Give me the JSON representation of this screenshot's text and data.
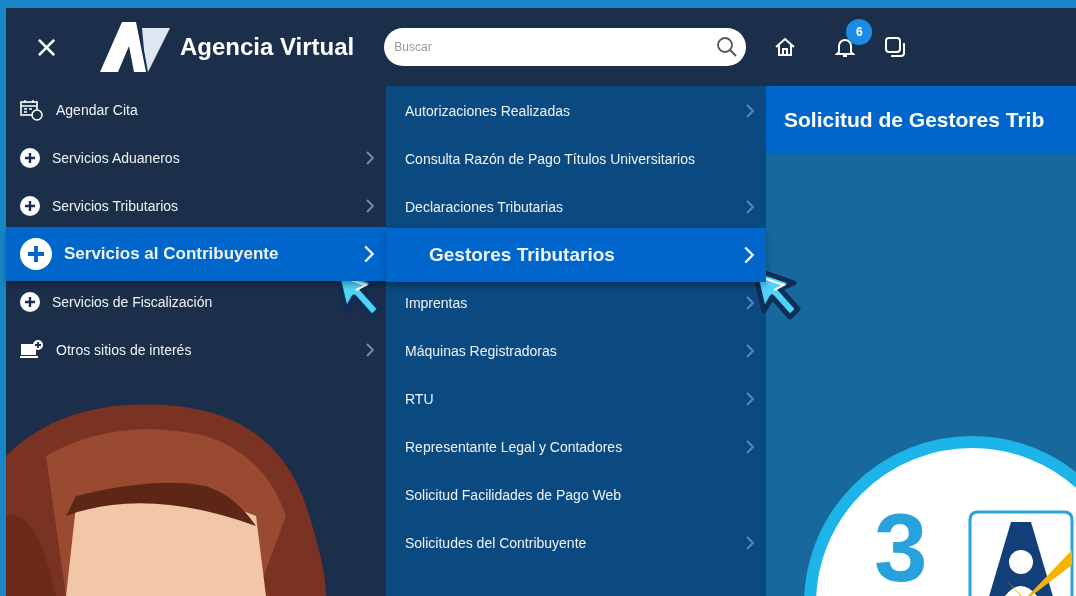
{
  "header": {
    "close": "×",
    "brand": "Agencia Virtual",
    "search": {
      "placeholder": "Buscar"
    },
    "notifications_count": "6"
  },
  "menu": [
    {
      "label": "Agendar Cita",
      "kind": "calendar",
      "has_submenu": false,
      "selected": false
    },
    {
      "label": "Servicios Aduaneros",
      "kind": "plus",
      "has_submenu": true,
      "selected": false
    },
    {
      "label": "Servicios Tributarios",
      "kind": "plus",
      "has_submenu": true,
      "selected": false
    },
    {
      "label": "Servicios al Contribuyente",
      "kind": "plus",
      "has_submenu": true,
      "selected": true
    },
    {
      "label": "Servicios de Fiscalización",
      "kind": "plus",
      "has_submenu": false,
      "selected": false
    },
    {
      "label": "Otros sitios de interés",
      "kind": "monitor",
      "has_submenu": true,
      "selected": false
    }
  ],
  "submenu": [
    {
      "label": "Autorizaciones Realizadas",
      "has_submenu": true,
      "selected": false
    },
    {
      "label": "Consulta Razón de Pago Títulos Universitarios",
      "has_submenu": false,
      "selected": false
    },
    {
      "label": "Declaraciones Tributarias",
      "has_submenu": true,
      "selected": false
    },
    {
      "label": "Gestores Tributarios",
      "has_submenu": true,
      "selected": true
    },
    {
      "label": "Imprentas",
      "has_submenu": true,
      "selected": false
    },
    {
      "label": "Máquinas Registradoras",
      "has_submenu": true,
      "selected": false
    },
    {
      "label": "RTU",
      "has_submenu": true,
      "selected": false
    },
    {
      "label": "Representante Legal y Contadores",
      "has_submenu": true,
      "selected": false
    },
    {
      "label": "Solicitud Facilidades de Pago Web",
      "has_submenu": false,
      "selected": false
    },
    {
      "label": "Solicitudes del Contribuyente",
      "has_submenu": true,
      "selected": false
    }
  ],
  "content": {
    "title": "Solicitud de Gestores Trib",
    "badge_logo": {
      "text": "3"
    }
  }
}
